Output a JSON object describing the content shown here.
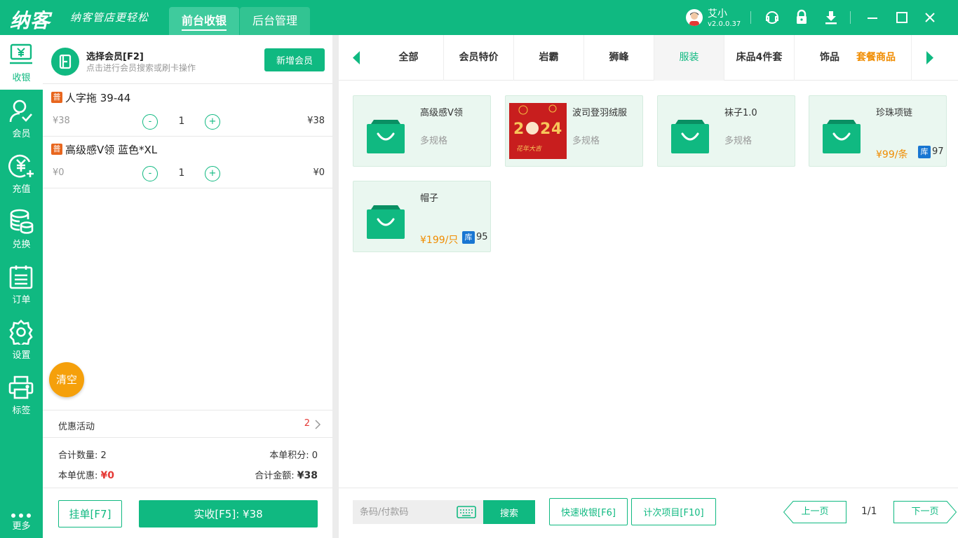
{
  "app": {
    "logo": "纳客",
    "slogan": "纳客管店更轻松",
    "tabs": [
      "前台收银",
      "后台管理"
    ],
    "user": {
      "name": "艾小",
      "version": "v2.0.0.37"
    },
    "top_icons": [
      "headset-icon",
      "lock-icon",
      "download-icon",
      "minimize-icon",
      "maximize-icon",
      "close-icon"
    ]
  },
  "sidebar": {
    "items": [
      {
        "label": "收银",
        "icon": "cashier-icon"
      },
      {
        "label": "会员",
        "icon": "member-icon"
      },
      {
        "label": "充值",
        "icon": "recharge-icon"
      },
      {
        "label": "兑换",
        "icon": "exchange-icon"
      },
      {
        "label": "订单",
        "icon": "order-icon"
      },
      {
        "label": "设置",
        "icon": "settings-icon"
      },
      {
        "label": "标签",
        "icon": "printer-icon"
      }
    ],
    "more": "更多"
  },
  "member": {
    "title": "选择会员[F2]",
    "subtitle": "点击进行会员搜索或刷卡操作",
    "new_button": "新增会员"
  },
  "cart": {
    "items": [
      {
        "badge": "普",
        "name": "人字拖 39-44",
        "price": "¥38",
        "qty": "1",
        "total": "¥38",
        "minus": "-",
        "plus": "+"
      },
      {
        "badge": "普",
        "name": "高级感V领 蓝色*XL",
        "price": "¥0",
        "qty": "1",
        "total": "¥0",
        "minus": "-",
        "plus": "+"
      }
    ],
    "clear": "清空"
  },
  "promo": {
    "label": "优惠活动",
    "count": "2"
  },
  "summary": {
    "count_label": "合计数量:",
    "count_value": "2",
    "points_label": "本单积分:",
    "points_value": "0",
    "discount_label": "本单优惠:",
    "discount_value": "¥0",
    "total_label": "合计金额:",
    "total_value": "¥38"
  },
  "actions": {
    "hang": "挂单[F7]",
    "pay": "实收[F5]: ¥38"
  },
  "categories": {
    "items": [
      "全部",
      "会员特价",
      "岩霸",
      "狮峰",
      "服装",
      "床品4件套",
      "饰品"
    ],
    "selected": "服装",
    "package": "套餐商品"
  },
  "products": [
    {
      "name": "高级感V领",
      "spec": "多规格",
      "image": "bag-icon"
    },
    {
      "name": "波司登羽绒服",
      "spec": "多规格",
      "image": "new-year-2024-image",
      "image_caption": "花年大吉"
    },
    {
      "name": "袜子1.0",
      "spec": "多规格",
      "image": "bag-icon"
    },
    {
      "name": "珍珠项链",
      "price": "¥99/条",
      "stock_badge": "库",
      "stock": "97",
      "image": "bag-icon"
    },
    {
      "name": "帽子",
      "price": "¥199/只",
      "stock_badge": "库",
      "stock": "95",
      "image": "bag-icon"
    }
  ],
  "bottom": {
    "search_placeholder": "条码/付款码",
    "search_button": "搜索",
    "quick_button": "快速收银[F6]",
    "count_button": "计次项目[F10]",
    "prev": "上一页",
    "next": "下一页",
    "page": "1/1"
  },
  "colors": {
    "primary": "#10b981",
    "orange": "#f08c00",
    "red": "#e53935",
    "stock_badge": "#1976d2",
    "clear": "#f5a00b"
  }
}
